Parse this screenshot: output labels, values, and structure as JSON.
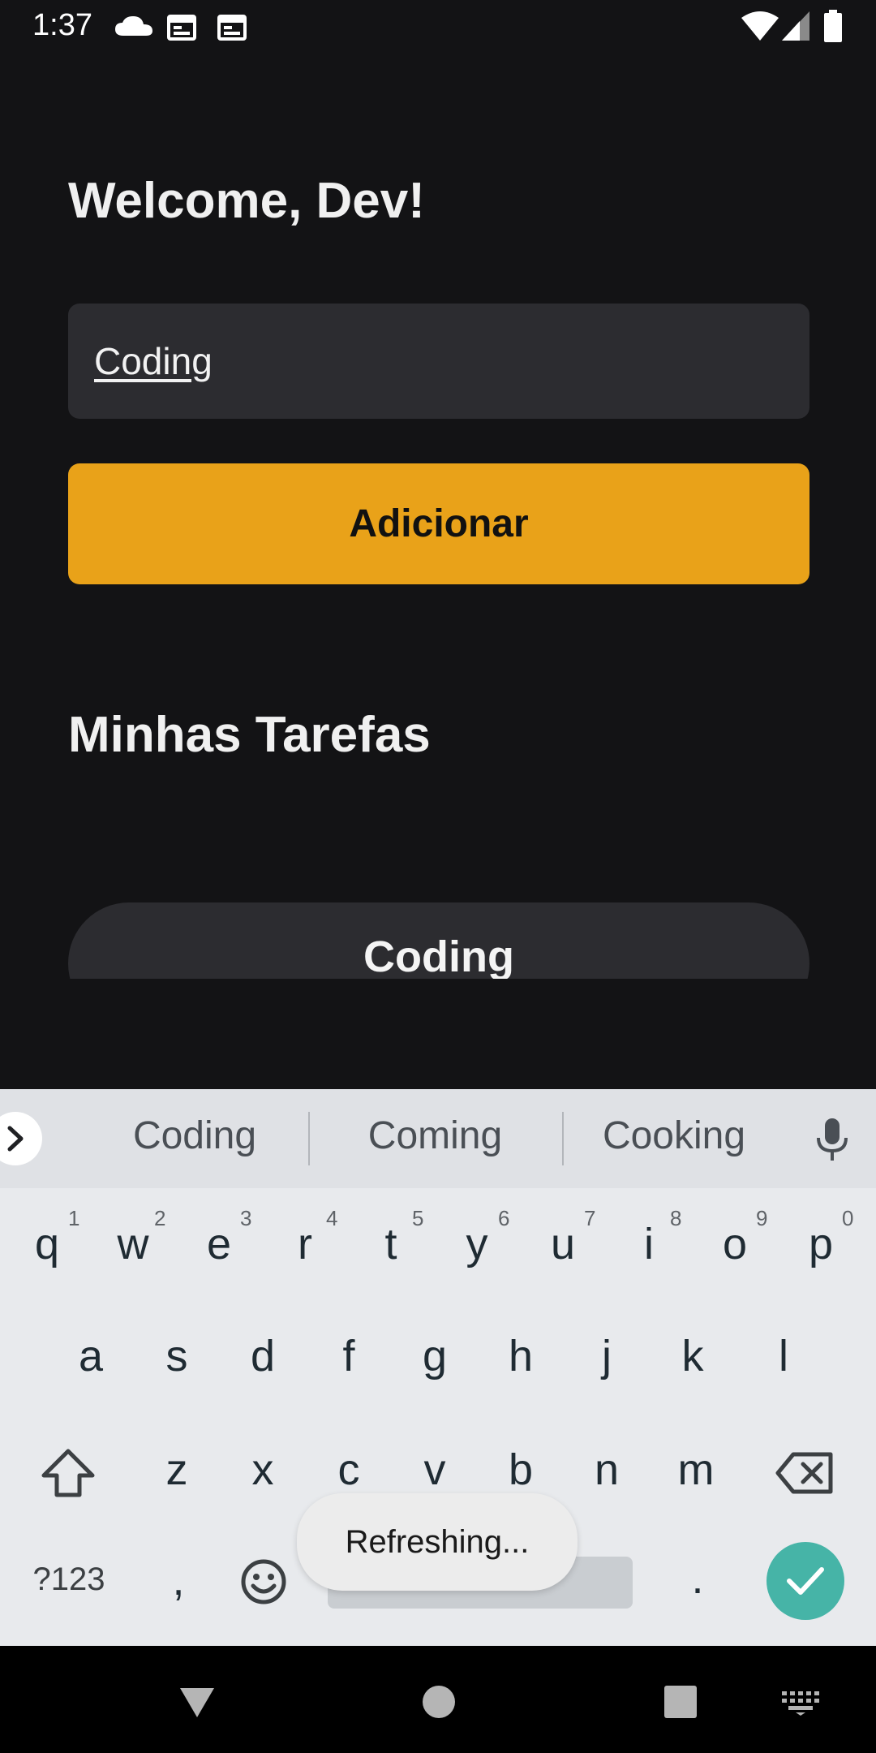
{
  "status_bar": {
    "time": "1:37",
    "icons": [
      "cloud-icon",
      "calendar-icon",
      "calendar-icon",
      "wifi-icon",
      "signal-icon",
      "battery-icon"
    ]
  },
  "app": {
    "greeting": "Welcome, Dev!",
    "task_input": {
      "value": "Coding",
      "placeholder": ""
    },
    "add_button_label": "Adicionar",
    "section_title": "Minhas Tarefas",
    "tasks": [
      {
        "label": "Coding"
      }
    ]
  },
  "keyboard": {
    "suggestions": [
      "Coding",
      "Coming",
      "Cooking"
    ],
    "row1": [
      {
        "key": "q",
        "hint": "1"
      },
      {
        "key": "w",
        "hint": "2"
      },
      {
        "key": "e",
        "hint": "3"
      },
      {
        "key": "r",
        "hint": "4"
      },
      {
        "key": "t",
        "hint": "5"
      },
      {
        "key": "y",
        "hint": "6"
      },
      {
        "key": "u",
        "hint": "7"
      },
      {
        "key": "i",
        "hint": "8"
      },
      {
        "key": "o",
        "hint": "9"
      },
      {
        "key": "p",
        "hint": "0"
      }
    ],
    "row2": [
      "a",
      "s",
      "d",
      "f",
      "g",
      "h",
      "j",
      "k",
      "l"
    ],
    "row3": [
      "z",
      "x",
      "c",
      "v",
      "b",
      "n",
      "m"
    ],
    "symbols_key": "?123",
    "comma_key": ",",
    "period_key": "."
  },
  "toast": "Refreshing...",
  "colors": {
    "background": "#131315",
    "surface": "#2c2c30",
    "accent": "#e9a219",
    "keyboard_bg": "#e8eaed",
    "enter_key": "#46b4a7"
  }
}
